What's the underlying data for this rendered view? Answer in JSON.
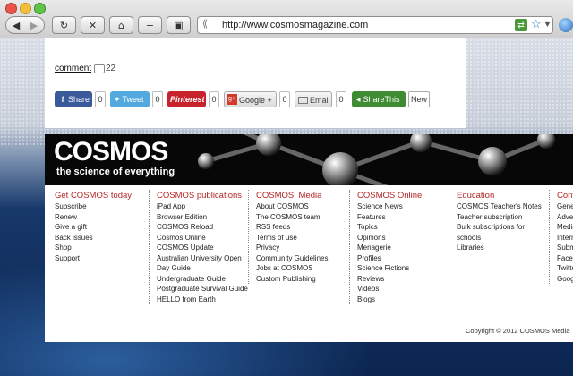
{
  "browser": {
    "url": "http://www.cosmosmagazine.com",
    "back_icon": "back-arrow-icon",
    "forward_icon": "forward-arrow-icon"
  },
  "article": {
    "comment_label": "comment",
    "comment_count": "22"
  },
  "share_bar": {
    "facebook": {
      "label": "Share",
      "count": "0",
      "icon": "f"
    },
    "twitter": {
      "label": "Tweet",
      "count": "0"
    },
    "pinterest": {
      "label": "Pinterest",
      "count": "0"
    },
    "googleplus": {
      "label": "Google +",
      "count": "0",
      "icon": "g+"
    },
    "email": {
      "label": "Email",
      "count": "0"
    },
    "sharethis": {
      "label": "ShareThis"
    },
    "new_label": "New"
  },
  "footer": {
    "logo": "COSMOS",
    "tagline": "the science of everything",
    "columns": [
      {
        "heading": "Get COSMOS today",
        "items": [
          "Subscribe",
          "Renew",
          "Give a gift",
          "Back issues",
          "Shop",
          "Support"
        ]
      },
      {
        "heading": "COSMOS publications",
        "items": [
          "iPad App",
          "Browser Edition",
          "COSMOS Reload",
          "Cosmos Online",
          "COSMOS Update",
          "Australian University Open",
          "Day Guide",
          "Undergraduate Guide",
          "Postgraduate Survival Guide",
          "HELLO from Earth"
        ]
      },
      {
        "heading": "COSMOS  Media",
        "items": [
          "About COSMOS",
          "The COSMOS team",
          "RSS feeds",
          "Terms of use",
          "Privacy",
          "Community Guidelines",
          "Jobs at COSMOS",
          "Custom Publishing"
        ]
      },
      {
        "heading": "COSMOS Online",
        "items": [
          "Science News",
          "Features",
          "Topics",
          "Opinions",
          "Menagerie",
          "Profiles",
          "Science Fictions",
          "Reviews",
          "Videos",
          "Blogs"
        ]
      },
      {
        "heading": "Education",
        "items": [
          "COSMOS Teacher's Notes",
          "Teacher subscription",
          "Bulk subscriptions for",
          "schools",
          "Libraries"
        ]
      },
      {
        "heading": "Conta",
        "items": [
          "Gener",
          "Adver",
          "Media",
          "Intern",
          "Subm",
          "Faceb",
          "Twitte",
          "Goog"
        ]
      }
    ],
    "copyright": "Copyright © 2012 COSMOS Media"
  },
  "colors": {
    "accent": "#b42625",
    "facebook": "#3b5a9a",
    "twitter": "#52a9e0",
    "pinterest": "#c8232c",
    "sharethis": "#3f8b34"
  }
}
